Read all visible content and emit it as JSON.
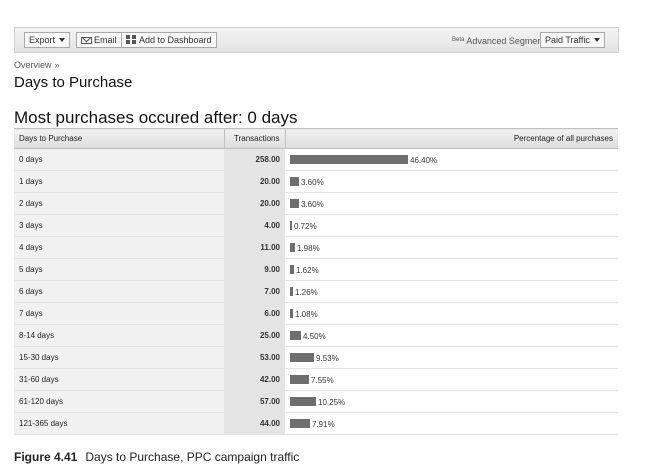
{
  "toolbar": {
    "export_label": "Export",
    "email_label": "Email",
    "dashboard_label": "Add to Dashboard",
    "beta_label": "Beta",
    "segments_label": "Advanced Segments:",
    "segment_value": "Paid Traffic"
  },
  "breadcrumb": {
    "overview": "Overview",
    "separator": "»"
  },
  "page": {
    "title": "Days to Purchase",
    "headline": "Most purchases occured after: 0 days"
  },
  "table": {
    "headers": {
      "days": "Days to Purchase",
      "transactions": "Transactions",
      "percentage": "Percentage of all purchases"
    },
    "rows": [
      {
        "days": "0 days",
        "transactions": "258.00",
        "pct_label": "46.40%",
        "pct": 46.4
      },
      {
        "days": "1 days",
        "transactions": "20.00",
        "pct_label": "3.60%",
        "pct": 3.6
      },
      {
        "days": "2 days",
        "transactions": "20.00",
        "pct_label": "3.60%",
        "pct": 3.6
      },
      {
        "days": "3 days",
        "transactions": "4.00",
        "pct_label": "0.72%",
        "pct": 0.72
      },
      {
        "days": "4 days",
        "transactions": "11.00",
        "pct_label": "1.98%",
        "pct": 1.98
      },
      {
        "days": "5 days",
        "transactions": "9.00",
        "pct_label": "1.62%",
        "pct": 1.62
      },
      {
        "days": "6 days",
        "transactions": "7.00",
        "pct_label": "1.26%",
        "pct": 1.26
      },
      {
        "days": "7 days",
        "transactions": "6.00",
        "pct_label": "1.08%",
        "pct": 1.08
      },
      {
        "days": "8-14 days",
        "transactions": "25.00",
        "pct_label": "4.50%",
        "pct": 4.5
      },
      {
        "days": "15-30 days",
        "transactions": "53.00",
        "pct_label": "9.53%",
        "pct": 9.53
      },
      {
        "days": "31-60 days",
        "transactions": "42.00",
        "pct_label": "7.55%",
        "pct": 7.55
      },
      {
        "days": "61-120 days",
        "transactions": "57.00",
        "pct_label": "10.25%",
        "pct": 10.25
      },
      {
        "days": "121-365 days",
        "transactions": "44.00",
        "pct_label": "7.91%",
        "pct": 7.91
      }
    ]
  },
  "caption": {
    "figure": "Figure 4.41",
    "text": "Days to Purchase, PPC campaign traffic"
  },
  "colors": {
    "bar": "#6e6e6e"
  }
}
